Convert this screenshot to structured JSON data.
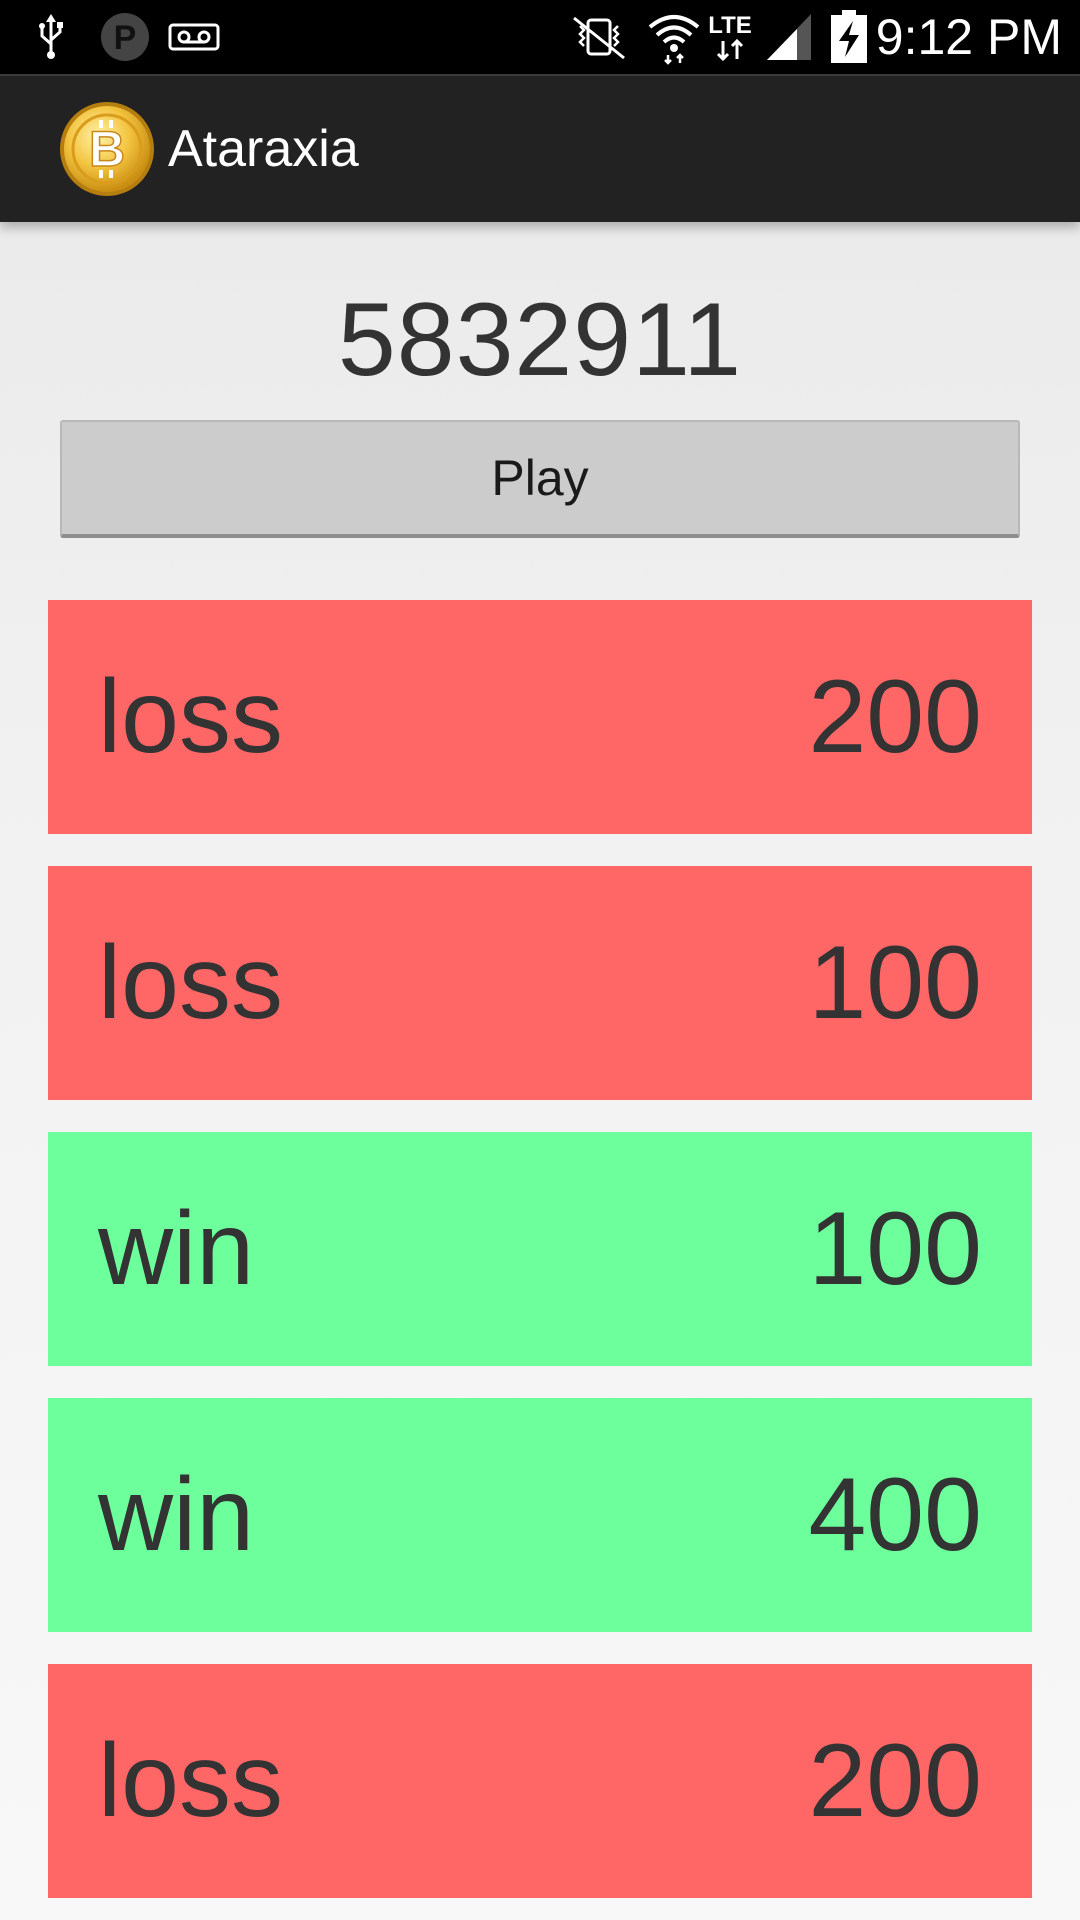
{
  "status_bar": {
    "time": "9:12 PM",
    "network_type": "LTE",
    "icons": [
      "usb-icon",
      "p-icon",
      "voicemail-icon",
      "vibrate-mute-icon",
      "wifi-icon",
      "lte-icon",
      "signal-icon",
      "battery-charging-icon"
    ]
  },
  "action_bar": {
    "title": "Ataraxia",
    "icon": "bitcoin-logo-icon"
  },
  "counter": {
    "value": "5832911"
  },
  "play_button": {
    "label": "Play"
  },
  "colors": {
    "loss": "#ff6666",
    "win": "#6cff9b",
    "text": "#333333",
    "action_bar": "#222222"
  },
  "results": [
    {
      "outcome": "loss",
      "amount": "200"
    },
    {
      "outcome": "loss",
      "amount": "100"
    },
    {
      "outcome": "win",
      "amount": "100"
    },
    {
      "outcome": "win",
      "amount": "400"
    },
    {
      "outcome": "loss",
      "amount": "200"
    }
  ]
}
